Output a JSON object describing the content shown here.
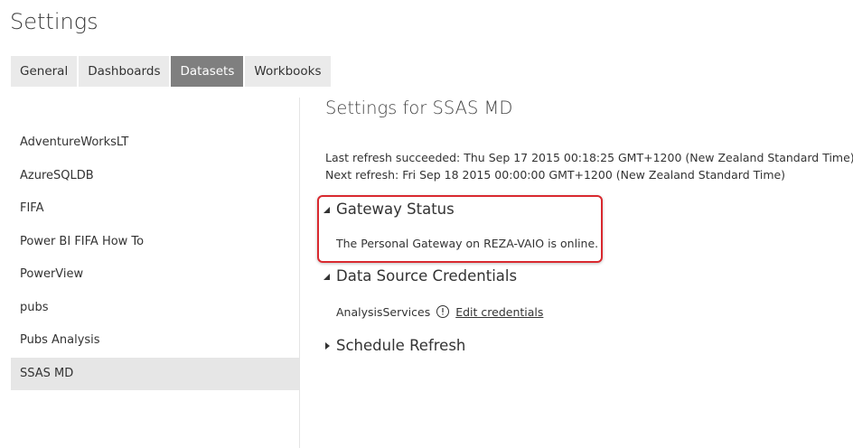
{
  "page": {
    "title": "Settings"
  },
  "tabs": [
    {
      "label": "General",
      "active": false
    },
    {
      "label": "Dashboards",
      "active": false
    },
    {
      "label": "Datasets",
      "active": true
    },
    {
      "label": "Workbooks",
      "active": false
    }
  ],
  "sidebar": {
    "items": [
      {
        "label": "AdventureWorksLT"
      },
      {
        "label": "AzureSQLDB"
      },
      {
        "label": "FIFA"
      },
      {
        "label": "Power BI FIFA How To"
      },
      {
        "label": "PowerView"
      },
      {
        "label": "pubs"
      },
      {
        "label": "Pubs Analysis"
      },
      {
        "label": "SSAS MD",
        "selected": true
      }
    ]
  },
  "main": {
    "title": "Settings for SSAS MD",
    "last_refresh": "Last refresh succeeded: Thu Sep 17 2015 00:18:25 GMT+1200 (New Zealand Standard Time)",
    "next_refresh": "Next refresh: Fri Sep 18 2015 00:00:00 GMT+1200 (New Zealand Standard Time)",
    "gateway": {
      "heading": "Gateway Status",
      "message": "The Personal Gateway on REZA-VAIO is online.",
      "expanded": true
    },
    "credentials": {
      "heading": "Data Source Credentials",
      "expanded": true,
      "source_name": "AnalysisServices",
      "edit_link": "Edit credentials"
    },
    "schedule": {
      "heading": "Schedule Refresh",
      "expanded": false
    }
  },
  "colors": {
    "active_tab_bg": "#7f7f7f",
    "highlight_border": "#d9292f",
    "selected_item_bg": "#e6e6e6"
  }
}
